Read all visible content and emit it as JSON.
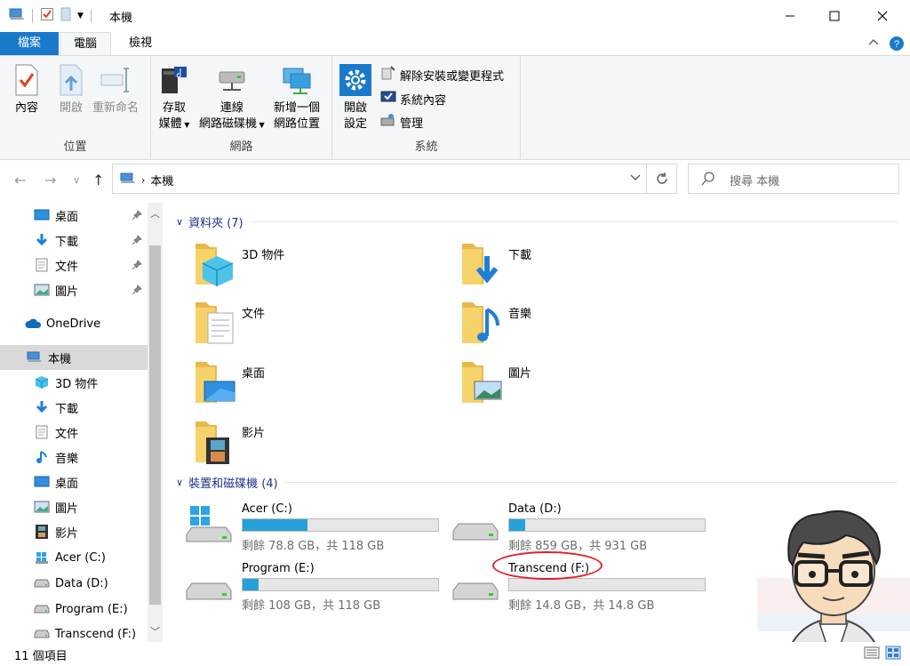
{
  "window": {
    "title": "本機"
  },
  "ribbon_tabs": [
    {
      "label": "檔案"
    },
    {
      "label": "電腦"
    },
    {
      "label": "檢視"
    }
  ],
  "ribbon": {
    "location_group": {
      "label": "位置",
      "properties": "內容",
      "open": "開啟",
      "rename": "重新命名"
    },
    "network_group": {
      "label": "網路",
      "access_media_1": "存取",
      "access_media_2": "媒體",
      "map_drive_1": "連線",
      "map_drive_2": "網路磁碟機",
      "add_location_1": "新增一個",
      "add_location_2": "網路位置"
    },
    "system_group": {
      "label": "系統",
      "open_settings_1": "開啟",
      "open_settings_2": "設定",
      "uninstall": "解除安裝或變更程式",
      "system_properties": "系統內容",
      "manage": "管理"
    }
  },
  "address": {
    "path": "本機",
    "search_placeholder": "搜尋 本機"
  },
  "nav_pane": {
    "quick": [
      {
        "label": "桌面"
      },
      {
        "label": "下載"
      },
      {
        "label": "文件"
      },
      {
        "label": "圖片"
      }
    ],
    "onedrive": "OneDrive",
    "this_pc": "本機",
    "pc_items": [
      {
        "label": "3D 物件"
      },
      {
        "label": "下載"
      },
      {
        "label": "文件"
      },
      {
        "label": "音樂"
      },
      {
        "label": "桌面"
      },
      {
        "label": "圖片"
      },
      {
        "label": "影片"
      },
      {
        "label": "Acer (C:)"
      },
      {
        "label": "Data (D:)"
      },
      {
        "label": "Program (E:)"
      },
      {
        "label": "Transcend (F:)"
      }
    ]
  },
  "content": {
    "folders_header": "資料夾 (7)",
    "folders": [
      {
        "name": "3D 物件"
      },
      {
        "name": "下載"
      },
      {
        "name": "文件"
      },
      {
        "name": "音樂"
      },
      {
        "name": "桌面"
      },
      {
        "name": "圖片"
      },
      {
        "name": "影片"
      }
    ],
    "drives_header": "裝置和磁碟機 (4)",
    "drives": [
      {
        "name": "Acer (C:)",
        "free": "剩餘 78.8 GB，共 118 GB",
        "used_fraction": 0.33
      },
      {
        "name": "Data (D:)",
        "free": "剩餘 859 GB，共 931 GB",
        "used_fraction": 0.08
      },
      {
        "name": "Program (E:)",
        "free": "剩餘 108 GB，共 118 GB",
        "used_fraction": 0.08
      },
      {
        "name": "Transcend (F:)",
        "free": "剩餘 14.8 GB，共 14.8 GB",
        "used_fraction": 0.0
      }
    ]
  },
  "status": {
    "count": "11 個項目"
  },
  "colors": {
    "accent": "#1979ca",
    "bar_fill": "#26a0da",
    "highlight_circle": "#e0202a",
    "group_header": "#1e3287"
  }
}
